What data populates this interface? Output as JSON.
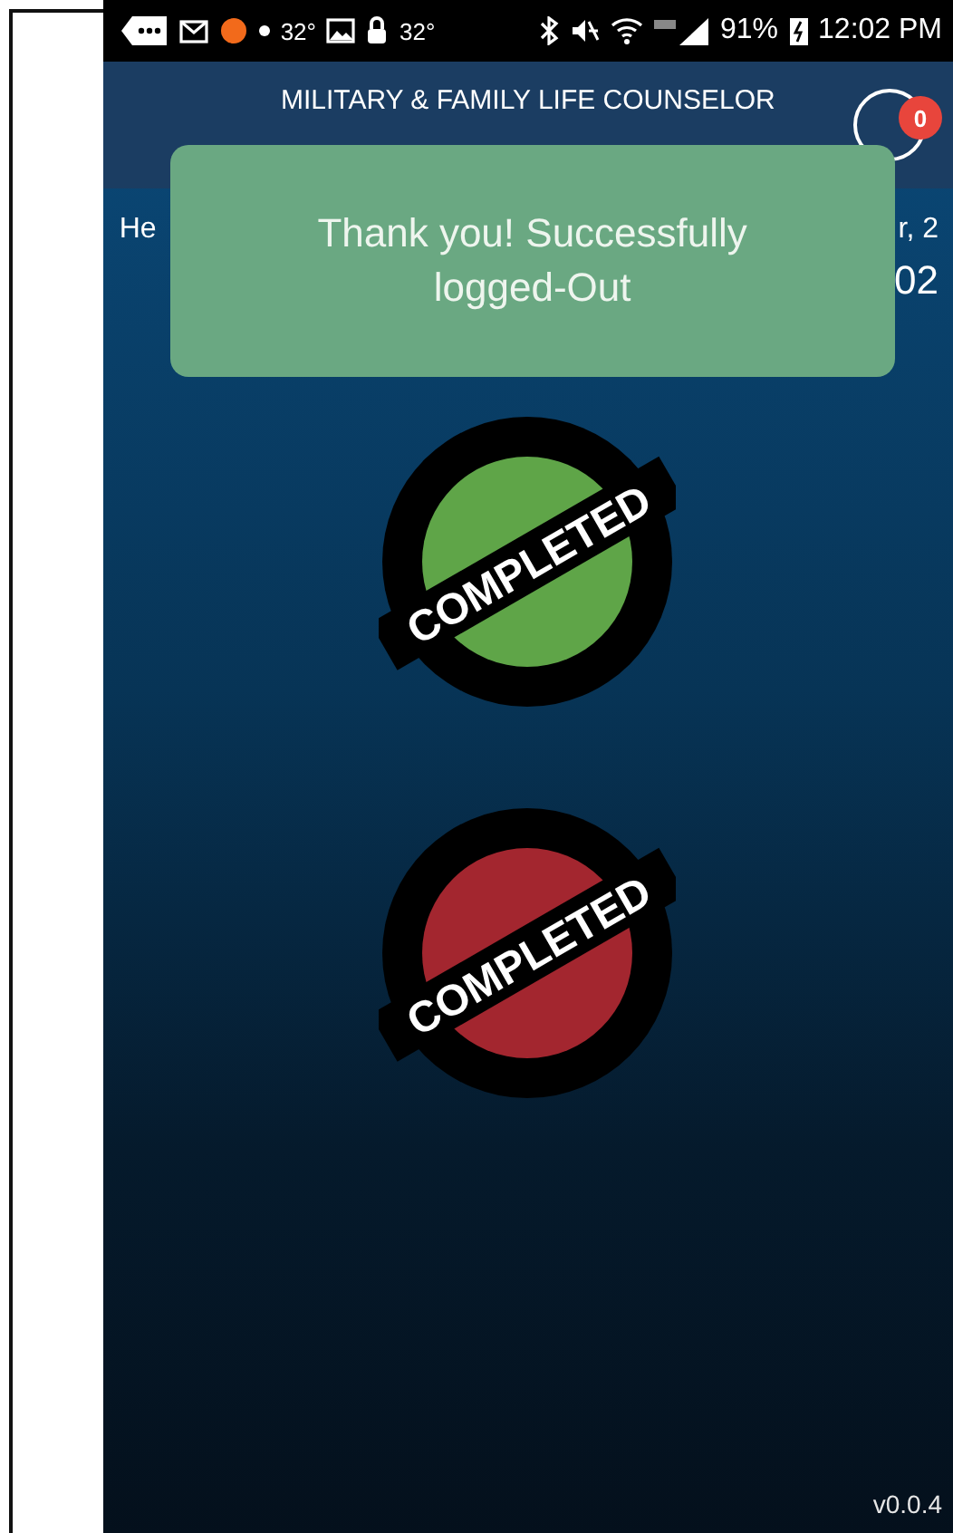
{
  "status_bar": {
    "temperatures": [
      "32°",
      "32°"
    ],
    "battery": "91%",
    "time": "12:02 PM"
  },
  "header": {
    "title": "MILITARY & FAMILY LIFE COUNSELOR",
    "notification_count": "0"
  },
  "greeting": {
    "left": "He",
    "right": "r, 2",
    "right_second_line": "02"
  },
  "toast": {
    "message": "Thank you! Successfully logged-Out"
  },
  "actions": [
    {
      "kind": "login",
      "stamp": "COMPLETED"
    },
    {
      "kind": "logout",
      "stamp": "COMPLETED"
    }
  ],
  "version": "v0.0.4"
}
